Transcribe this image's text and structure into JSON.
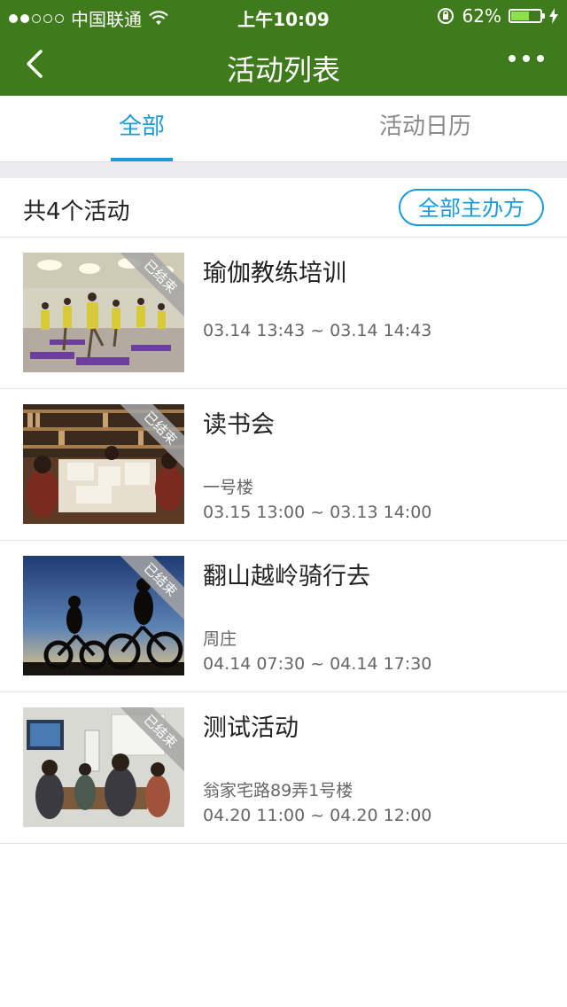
{
  "status_bar": {
    "carrier": "中国联通",
    "time": "上午10:09",
    "battery": "62%",
    "signal_strength": 2,
    "battery_level": 0.62,
    "icons": [
      "wifi-icon",
      "orientation-lock-icon",
      "battery-icon",
      "charging-icon"
    ]
  },
  "nav": {
    "title": "活动列表",
    "back_icon": "chevron-left-icon",
    "more_icon": "more-dots-icon"
  },
  "tabs": [
    {
      "label": "全部",
      "active": true
    },
    {
      "label": "活动日历",
      "active": false
    }
  ],
  "summary": {
    "count_text": "共4个活动",
    "organizer_button": "全部主办方"
  },
  "activities": [
    {
      "title": "瑜伽教练培训",
      "location": "",
      "time": "03.14 13:43 ~ 03.14 14:43",
      "status": "已结束",
      "thumb": "yoga-class-photo"
    },
    {
      "title": "读书会",
      "location": "一号楼",
      "time": "03.15 13:00 ~ 03.13 14:00",
      "status": "已结束",
      "thumb": "book-club-photo"
    },
    {
      "title": "翻山越岭骑行去",
      "location": "周庄",
      "time": "04.14 07:30 ~ 04.14 17:30",
      "status": "已结束",
      "thumb": "cycling-silhouette-photo"
    },
    {
      "title": "测试活动",
      "location": "翁家宅路89弄1号楼",
      "time": "04.20 11:00 ~ 04.20 12:00",
      "status": "已结束",
      "thumb": "meeting-room-photo"
    }
  ],
  "colors": {
    "nav_green": "#3f7a1c",
    "accent_blue": "#1a9bd7"
  }
}
